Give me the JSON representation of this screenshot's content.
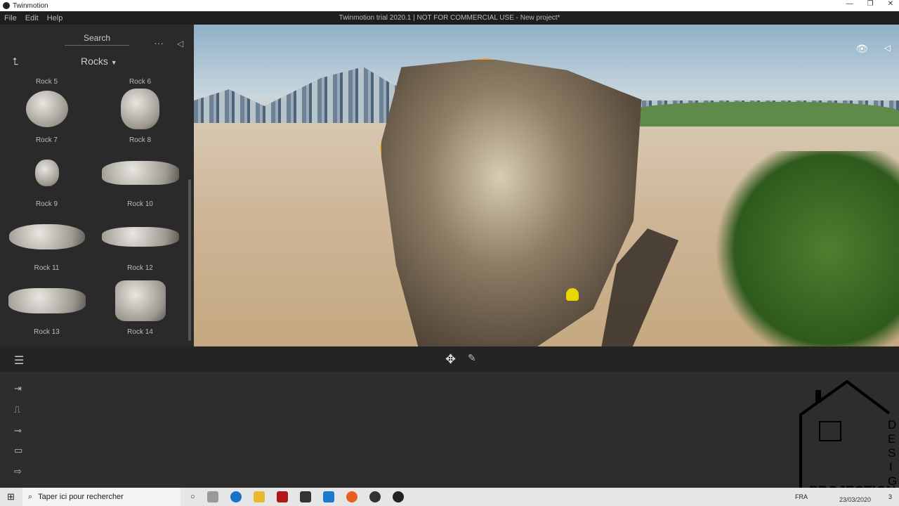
{
  "window": {
    "title": "Twinmotion",
    "controls": [
      "—",
      "❐",
      "✕"
    ]
  },
  "menu": {
    "items": [
      "File",
      "Edit",
      "Help"
    ],
    "app_title": "Twinmotion trial 2020.1 | NOT FOR COMMERCIAL USE - New project*"
  },
  "library": {
    "search_label": "Search",
    "category": "Rocks",
    "items": [
      {
        "label": "Rock 5"
      },
      {
        "label": "Rock 6"
      },
      {
        "label": "Rock 7"
      },
      {
        "label": "Rock 8"
      },
      {
        "label": "Rock 9"
      },
      {
        "label": "Rock 10"
      },
      {
        "label": "Rock 11"
      },
      {
        "label": "Rock 12"
      },
      {
        "label": "Rock 13"
      },
      {
        "label": "Rock 14"
      }
    ]
  },
  "colors": {
    "selection_outline": "#f0a020",
    "gizmo": "#e8d800"
  },
  "taskbar": {
    "search_placeholder": "Taper ici pour rechercher",
    "language": "FRA",
    "date": "23/03/2020",
    "notifications": "3"
  },
  "watermark": {
    "text": "PROJECTION DESIG"
  }
}
